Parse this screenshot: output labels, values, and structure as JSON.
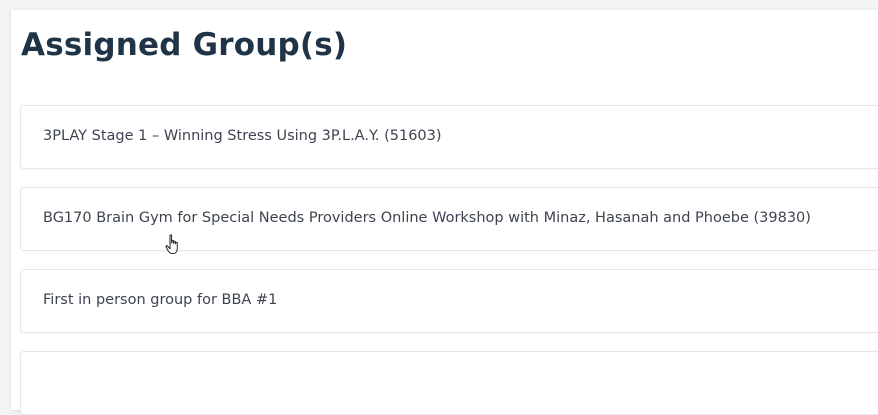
{
  "header": {
    "title": "Assigned Group(s)"
  },
  "groups": [
    {
      "label": "3PLAY Stage 1 – Winning Stress Using 3P.L.A.Y. (51603)"
    },
    {
      "label": "BG170 Brain Gym for Special Needs Providers Online Workshop with Minaz, Hasanah and Phoebe (39830)"
    },
    {
      "label": "First in person group for BBA #1"
    },
    {
      "label": ""
    }
  ],
  "colors": {
    "title": "#1f3446",
    "text": "#3d4450",
    "border": "#e4e6e8",
    "background": "#f3f4f5"
  },
  "icons": {
    "cursor": "hand-pointer-icon"
  }
}
